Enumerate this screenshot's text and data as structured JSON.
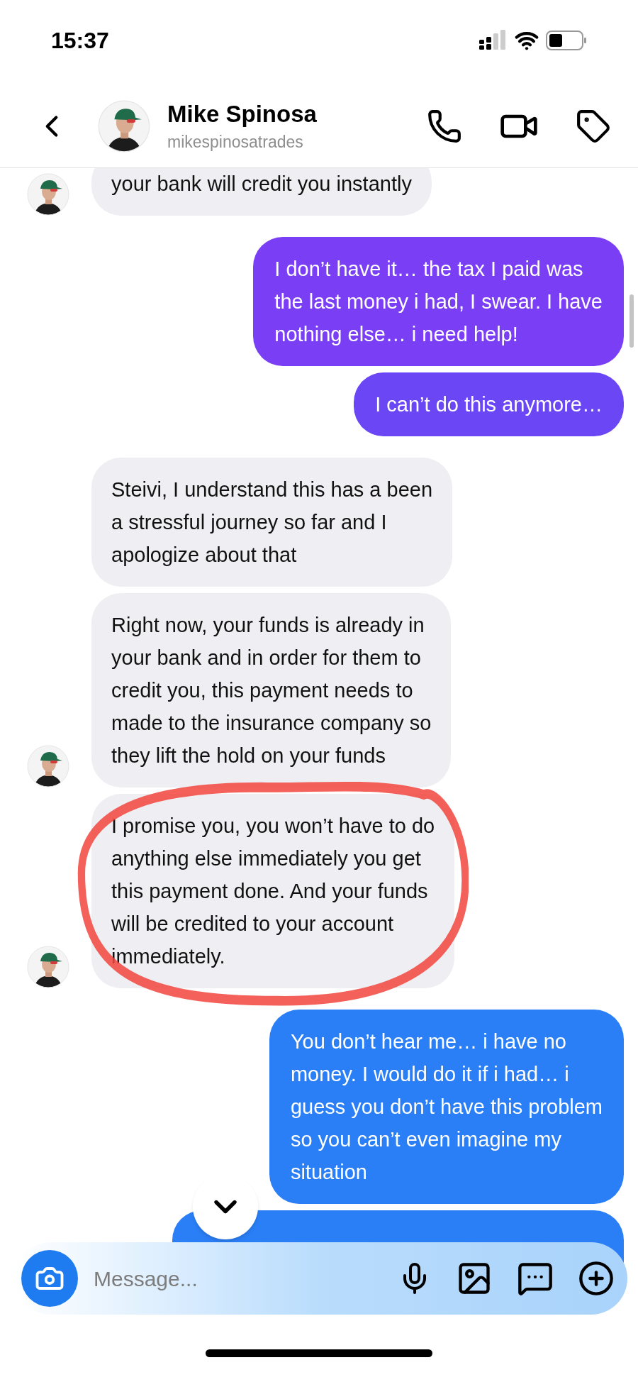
{
  "status_bar": {
    "time": "15:37"
  },
  "header": {
    "name": "Mike Spinosa",
    "username": "mikespinosatrades"
  },
  "messages": [
    {
      "kind": "received",
      "avatar": true,
      "highlighted": false,
      "lines": [
        "your bank will credit you instantly"
      ]
    },
    {
      "kind": "sent",
      "color": "#7a3ff4",
      "lines": [
        "I don’t have it… the tax I paid was",
        "the last money i had, I swear. I have",
        "nothing else… i need help!"
      ]
    },
    {
      "kind": "sent",
      "color": "#6a46f5",
      "lines": [
        "I can’t do this anymore…"
      ]
    },
    {
      "kind": "received",
      "avatar": false,
      "highlighted": false,
      "lines": [
        "Steivi, I understand this has a been",
        "a stressful journey so far and I",
        "apologize about that"
      ]
    },
    {
      "kind": "received",
      "avatar": true,
      "highlighted": false,
      "lines": [
        "Right now, your funds is already in",
        "your bank and in order for them to",
        "credit you, this payment needs to",
        "made to the insurance company so",
        "they lift the hold on your funds"
      ]
    },
    {
      "kind": "received",
      "avatar": true,
      "highlighted": true,
      "lines": [
        "I promise you, you won’t have to do",
        "anything else immediately you get",
        "this payment done. And your funds",
        "will be credited to your account",
        "immediately."
      ]
    },
    {
      "kind": "sent",
      "color": "#2a7ef6",
      "lines": [
        "You don’t hear me… i have no",
        "money. I would do it if i had… i",
        "guess you don’t have this problem",
        "so you can’t even imagine my",
        "situation"
      ]
    },
    {
      "kind": "sent",
      "color": "#2a7ef6"
    }
  ],
  "composer": {
    "placeholder": "Message..."
  }
}
